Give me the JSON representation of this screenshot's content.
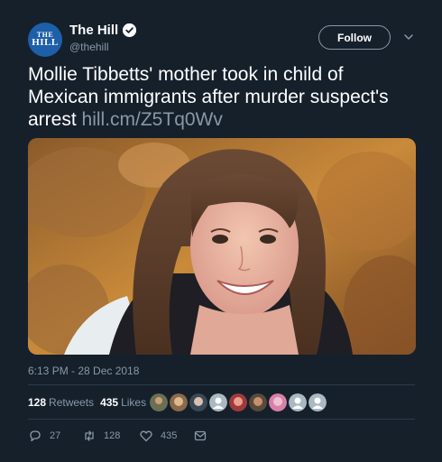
{
  "account": {
    "avatar_line1": "THE",
    "avatar_line2": "HILL",
    "display_name": "The Hill",
    "handle": "@thehill"
  },
  "follow_label": "Follow",
  "tweet": {
    "text": "Mollie Tibbetts' mother took in child of Mexican immigrants after murder suspect's arrest ",
    "link": "hill.cm/Z5Tq0Wv",
    "timestamp": "6:13 PM - 28 Dec 2018"
  },
  "stats": {
    "retweets_count": "128",
    "retweets_label": "Retweets",
    "likes_count": "435",
    "likes_label": "Likes"
  },
  "actions": {
    "reply_count": "27",
    "retweet_count": "128",
    "like_count": "435"
  },
  "colors": {
    "background": "#15202b",
    "secondary_text": "#8899a6",
    "brand_avatar": "#1d5fa8"
  },
  "icons": [
    "verified-icon",
    "chevron-down-icon",
    "reply-icon",
    "retweet-icon",
    "heart-icon",
    "message-icon"
  ]
}
